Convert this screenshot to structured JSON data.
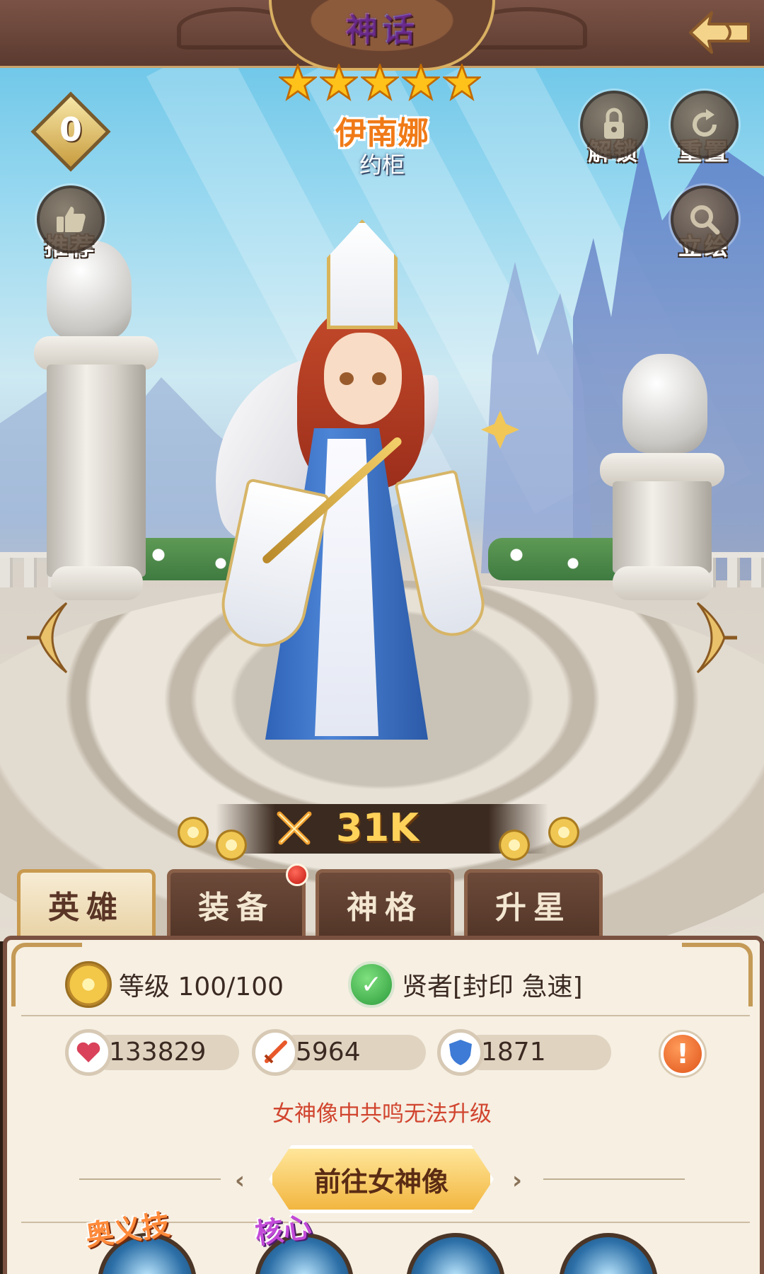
{
  "header": {
    "rarity_label": "神话",
    "back_icon": "back-arrow-icon",
    "star_count": 5
  },
  "hero": {
    "name": "伊南娜",
    "faction": "约柜",
    "rank_badge": "0"
  },
  "buttons": {
    "unlock": "解锁",
    "reset": "重置",
    "recommend": "推荐",
    "portrait": "立绘"
  },
  "power": {
    "value": "31K",
    "icon": "crossed-swords-icon"
  },
  "tabs": [
    {
      "label": "英雄",
      "active": true
    },
    {
      "label": "装备",
      "active": false,
      "has_notification": true
    },
    {
      "label": "神格",
      "active": false
    },
    {
      "label": "升星",
      "active": false
    }
  ],
  "info": {
    "level_text": "等级 100/100",
    "class_text": "贤者[封印 急速]"
  },
  "stats": [
    {
      "icon": "heart-icon",
      "value": "133829"
    },
    {
      "icon": "sword-icon",
      "value": "5964"
    },
    {
      "icon": "shield-icon",
      "value": "1871"
    }
  ],
  "notice": "女神像中共鸣无法升级",
  "goto_button": "前往女神像",
  "skills": {
    "ultimate_tag": "奥义技",
    "core_tag": "核心"
  },
  "colors": {
    "accent_orange": "#f07a17",
    "tab_active_bg": "#f7ecd4",
    "tab_inactive_bg": "#6d4a3a",
    "notice_red": "#d1452f",
    "power_gold": "#ffd25a"
  }
}
